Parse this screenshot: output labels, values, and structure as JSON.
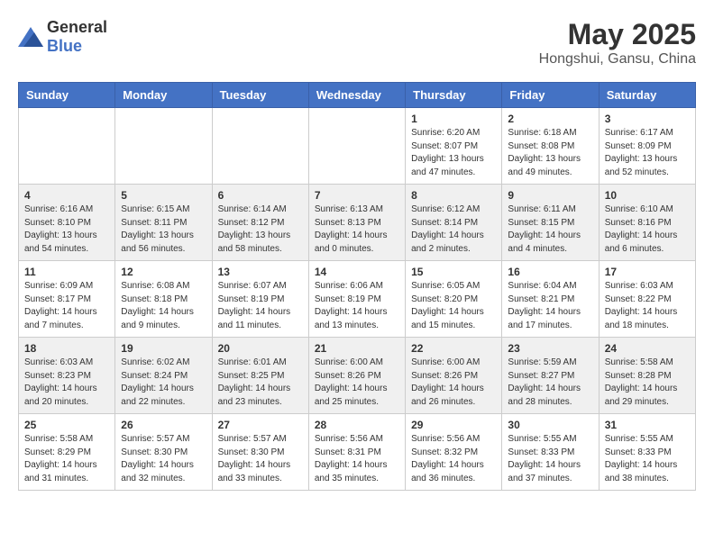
{
  "header": {
    "logo": {
      "text_general": "General",
      "text_blue": "Blue"
    },
    "title": "May 2025",
    "location": "Hongshui, Gansu, China"
  },
  "days_of_week": [
    "Sunday",
    "Monday",
    "Tuesday",
    "Wednesday",
    "Thursday",
    "Friday",
    "Saturday"
  ],
  "weeks": [
    [
      {
        "day": "",
        "info": ""
      },
      {
        "day": "",
        "info": ""
      },
      {
        "day": "",
        "info": ""
      },
      {
        "day": "",
        "info": ""
      },
      {
        "day": "1",
        "info": "Sunrise: 6:20 AM\nSunset: 8:07 PM\nDaylight: 13 hours\nand 47 minutes."
      },
      {
        "day": "2",
        "info": "Sunrise: 6:18 AM\nSunset: 8:08 PM\nDaylight: 13 hours\nand 49 minutes."
      },
      {
        "day": "3",
        "info": "Sunrise: 6:17 AM\nSunset: 8:09 PM\nDaylight: 13 hours\nand 52 minutes."
      }
    ],
    [
      {
        "day": "4",
        "info": "Sunrise: 6:16 AM\nSunset: 8:10 PM\nDaylight: 13 hours\nand 54 minutes."
      },
      {
        "day": "5",
        "info": "Sunrise: 6:15 AM\nSunset: 8:11 PM\nDaylight: 13 hours\nand 56 minutes."
      },
      {
        "day": "6",
        "info": "Sunrise: 6:14 AM\nSunset: 8:12 PM\nDaylight: 13 hours\nand 58 minutes."
      },
      {
        "day": "7",
        "info": "Sunrise: 6:13 AM\nSunset: 8:13 PM\nDaylight: 14 hours\nand 0 minutes."
      },
      {
        "day": "8",
        "info": "Sunrise: 6:12 AM\nSunset: 8:14 PM\nDaylight: 14 hours\nand 2 minutes."
      },
      {
        "day": "9",
        "info": "Sunrise: 6:11 AM\nSunset: 8:15 PM\nDaylight: 14 hours\nand 4 minutes."
      },
      {
        "day": "10",
        "info": "Sunrise: 6:10 AM\nSunset: 8:16 PM\nDaylight: 14 hours\nand 6 minutes."
      }
    ],
    [
      {
        "day": "11",
        "info": "Sunrise: 6:09 AM\nSunset: 8:17 PM\nDaylight: 14 hours\nand 7 minutes."
      },
      {
        "day": "12",
        "info": "Sunrise: 6:08 AM\nSunset: 8:18 PM\nDaylight: 14 hours\nand 9 minutes."
      },
      {
        "day": "13",
        "info": "Sunrise: 6:07 AM\nSunset: 8:19 PM\nDaylight: 14 hours\nand 11 minutes."
      },
      {
        "day": "14",
        "info": "Sunrise: 6:06 AM\nSunset: 8:19 PM\nDaylight: 14 hours\nand 13 minutes."
      },
      {
        "day": "15",
        "info": "Sunrise: 6:05 AM\nSunset: 8:20 PM\nDaylight: 14 hours\nand 15 minutes."
      },
      {
        "day": "16",
        "info": "Sunrise: 6:04 AM\nSunset: 8:21 PM\nDaylight: 14 hours\nand 17 minutes."
      },
      {
        "day": "17",
        "info": "Sunrise: 6:03 AM\nSunset: 8:22 PM\nDaylight: 14 hours\nand 18 minutes."
      }
    ],
    [
      {
        "day": "18",
        "info": "Sunrise: 6:03 AM\nSunset: 8:23 PM\nDaylight: 14 hours\nand 20 minutes."
      },
      {
        "day": "19",
        "info": "Sunrise: 6:02 AM\nSunset: 8:24 PM\nDaylight: 14 hours\nand 22 minutes."
      },
      {
        "day": "20",
        "info": "Sunrise: 6:01 AM\nSunset: 8:25 PM\nDaylight: 14 hours\nand 23 minutes."
      },
      {
        "day": "21",
        "info": "Sunrise: 6:00 AM\nSunset: 8:26 PM\nDaylight: 14 hours\nand 25 minutes."
      },
      {
        "day": "22",
        "info": "Sunrise: 6:00 AM\nSunset: 8:26 PM\nDaylight: 14 hours\nand 26 minutes."
      },
      {
        "day": "23",
        "info": "Sunrise: 5:59 AM\nSunset: 8:27 PM\nDaylight: 14 hours\nand 28 minutes."
      },
      {
        "day": "24",
        "info": "Sunrise: 5:58 AM\nSunset: 8:28 PM\nDaylight: 14 hours\nand 29 minutes."
      }
    ],
    [
      {
        "day": "25",
        "info": "Sunrise: 5:58 AM\nSunset: 8:29 PM\nDaylight: 14 hours\nand 31 minutes."
      },
      {
        "day": "26",
        "info": "Sunrise: 5:57 AM\nSunset: 8:30 PM\nDaylight: 14 hours\nand 32 minutes."
      },
      {
        "day": "27",
        "info": "Sunrise: 5:57 AM\nSunset: 8:30 PM\nDaylight: 14 hours\nand 33 minutes."
      },
      {
        "day": "28",
        "info": "Sunrise: 5:56 AM\nSunset: 8:31 PM\nDaylight: 14 hours\nand 35 minutes."
      },
      {
        "day": "29",
        "info": "Sunrise: 5:56 AM\nSunset: 8:32 PM\nDaylight: 14 hours\nand 36 minutes."
      },
      {
        "day": "30",
        "info": "Sunrise: 5:55 AM\nSunset: 8:33 PM\nDaylight: 14 hours\nand 37 minutes."
      },
      {
        "day": "31",
        "info": "Sunrise: 5:55 AM\nSunset: 8:33 PM\nDaylight: 14 hours\nand 38 minutes."
      }
    ]
  ]
}
